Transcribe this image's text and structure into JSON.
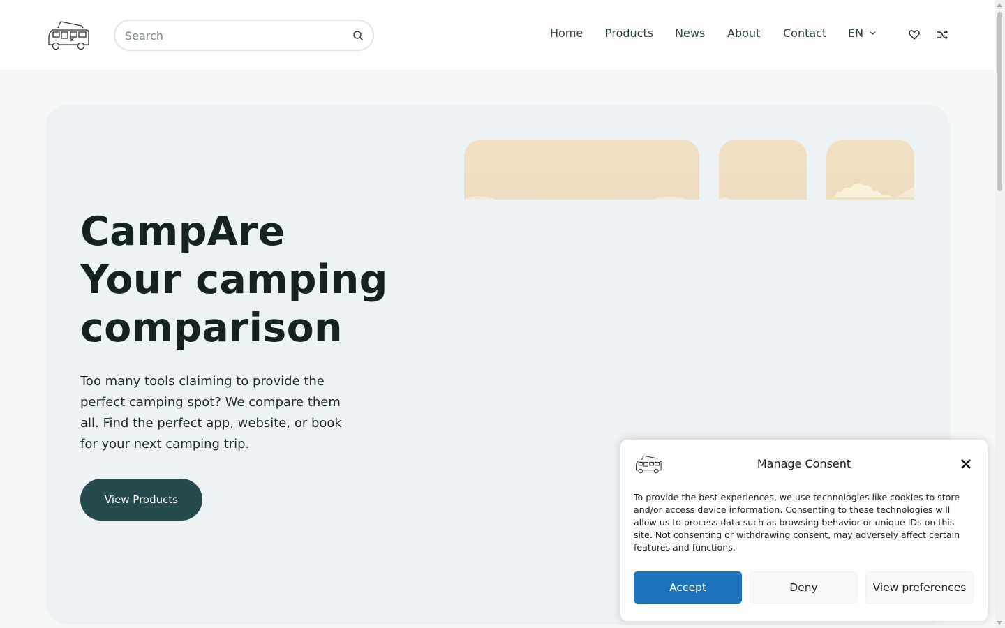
{
  "header": {
    "search": {
      "placeholder": "Search",
      "value": ""
    },
    "nav": [
      {
        "label": "Home"
      },
      {
        "label": "Products"
      },
      {
        "label": "News"
      },
      {
        "label": "About"
      },
      {
        "label": "Contact"
      }
    ],
    "language": "EN",
    "icons": [
      "camper-van-logo",
      "search-icon",
      "chevron-down-icon",
      "heart-icon",
      "shuffle-icon"
    ]
  },
  "hero": {
    "title_lines": [
      "CampAre",
      "Your camping",
      "comparison"
    ],
    "description": "Too many tools claiming to provide the perfect camping spot? We compare them all. Find the perfect app, website, or book for your next camping trip.",
    "cta_label": "View Products"
  },
  "consent": {
    "title": "Manage Consent",
    "text": "To provide the best experiences, we use technologies like cookies to store and/or access device information. Consenting to these technologies will allow us to process data such as browsing behavior or unique IDs on this site. Not consenting or withdrawing consent, may adversely affect certain features and functions.",
    "accept_label": "Accept",
    "deny_label": "Deny",
    "preferences_label": "View preferences"
  },
  "colors": {
    "primary": "#244b4d",
    "accept": "#1e73be",
    "hero_bg": "#edf2f5",
    "card_sand": "#f1dfc2"
  }
}
